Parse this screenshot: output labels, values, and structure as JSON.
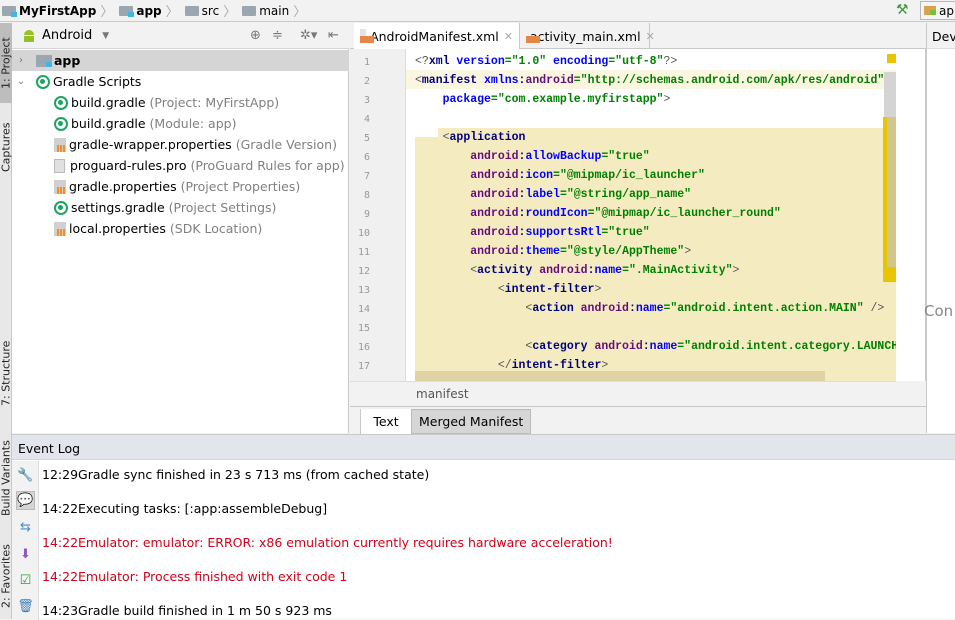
{
  "navbar": {
    "crumbs": [
      {
        "label": "MyFirstApp",
        "bold": true,
        "icon": "module-folder-icon"
      },
      {
        "label": "app",
        "bold": true,
        "icon": "module-folder-icon"
      },
      {
        "label": "src",
        "bold": false,
        "icon": "folder-icon"
      },
      {
        "label": "main",
        "bold": false,
        "icon": "folder-icon"
      }
    ],
    "run_config_label": "ap"
  },
  "left_strip": {
    "tabs": [
      "1: Project",
      "Captures",
      "7: Structure",
      "Build Variants",
      "2: Favorites"
    ]
  },
  "project_panel": {
    "view_selector": "Android",
    "tree": [
      {
        "label": "app",
        "hint": "",
        "icon": "module-folder-icon",
        "expanded": false,
        "selected": true,
        "level": 0
      },
      {
        "label": "Gradle Scripts",
        "hint": "",
        "icon": "gradle-icon",
        "expanded": true,
        "selected": false,
        "level": 0
      },
      {
        "label": "build.gradle",
        "hint": "(Project: MyFirstApp)",
        "icon": "gradle-icon",
        "level": 1
      },
      {
        "label": "build.gradle",
        "hint": "(Module: app)",
        "icon": "gradle-icon",
        "level": 1
      },
      {
        "label": "gradle-wrapper.properties",
        "hint": "(Gradle Version)",
        "icon": "properties-icon",
        "level": 1
      },
      {
        "label": "proguard-rules.pro",
        "hint": "(ProGuard Rules for app)",
        "icon": "text-file-icon",
        "level": 1
      },
      {
        "label": "gradle.properties",
        "hint": "(Project Properties)",
        "icon": "properties-icon",
        "level": 1
      },
      {
        "label": "settings.gradle",
        "hint": "(Project Settings)",
        "icon": "gradle-icon",
        "level": 1
      },
      {
        "label": "local.properties",
        "hint": "(SDK Location)",
        "icon": "properties-icon",
        "level": 1
      }
    ]
  },
  "editor": {
    "tabs": [
      {
        "label": "AndroidManifest.xml",
        "active": true
      },
      {
        "label": "activity_main.xml",
        "active": false
      }
    ],
    "line_numbers": [
      "1",
      "2",
      "3",
      "4",
      "5",
      "6",
      "7",
      "8",
      "9",
      "10",
      "11",
      "12",
      "13",
      "14",
      "15",
      "16",
      "17"
    ],
    "lines": [
      [
        {
          "c": "p",
          "t": "<?"
        },
        {
          "c": "t",
          "t": "xml "
        },
        {
          "c": "a",
          "t": "version"
        },
        {
          "c": "v",
          "t": "=\"1.0\" "
        },
        {
          "c": "a",
          "t": "encoding"
        },
        {
          "c": "v",
          "t": "=\"utf-8\""
        },
        {
          "c": "p",
          "t": "?>"
        }
      ],
      [
        {
          "c": "p",
          "t": "<"
        },
        {
          "c": "t",
          "t": "manifest "
        },
        {
          "c": "a",
          "t": "xmlns"
        },
        {
          "c": "t",
          "t": ":"
        },
        {
          "c": "n",
          "t": "android"
        },
        {
          "c": "v",
          "t": "=\"http://schemas.android.com/apk/res/android\""
        }
      ],
      [
        {
          "c": "t",
          "t": "    "
        },
        {
          "c": "a",
          "t": "package"
        },
        {
          "c": "v",
          "t": "=\"com.example.myfirstapp\""
        },
        {
          "c": "p",
          "t": ">"
        }
      ],
      [],
      [
        {
          "c": "t",
          "t": "    "
        },
        {
          "c": "p",
          "t": "<"
        },
        {
          "c": "t",
          "t": "application"
        }
      ],
      [
        {
          "c": "t",
          "t": "        "
        },
        {
          "c": "n",
          "t": "android"
        },
        {
          "c": "t",
          "t": ":"
        },
        {
          "c": "a",
          "t": "allowBackup"
        },
        {
          "c": "v",
          "t": "=\"true\""
        }
      ],
      [
        {
          "c": "t",
          "t": "        "
        },
        {
          "c": "n",
          "t": "android"
        },
        {
          "c": "t",
          "t": ":"
        },
        {
          "c": "a",
          "t": "icon"
        },
        {
          "c": "v",
          "t": "=\"@mipmap/ic_launcher\""
        }
      ],
      [
        {
          "c": "t",
          "t": "        "
        },
        {
          "c": "n",
          "t": "android"
        },
        {
          "c": "t",
          "t": ":"
        },
        {
          "c": "a",
          "t": "label"
        },
        {
          "c": "v",
          "t": "=\"@string/app_name\""
        }
      ],
      [
        {
          "c": "t",
          "t": "        "
        },
        {
          "c": "n",
          "t": "android"
        },
        {
          "c": "t",
          "t": ":"
        },
        {
          "c": "a",
          "t": "roundIcon"
        },
        {
          "c": "v",
          "t": "=\"@mipmap/ic_launcher_round\""
        }
      ],
      [
        {
          "c": "t",
          "t": "        "
        },
        {
          "c": "n",
          "t": "android"
        },
        {
          "c": "t",
          "t": ":"
        },
        {
          "c": "a",
          "t": "supportsRtl"
        },
        {
          "c": "v",
          "t": "=\"true\""
        }
      ],
      [
        {
          "c": "t",
          "t": "        "
        },
        {
          "c": "n",
          "t": "android"
        },
        {
          "c": "t",
          "t": ":"
        },
        {
          "c": "a",
          "t": "theme"
        },
        {
          "c": "v",
          "t": "=\"@style/AppTheme\""
        },
        {
          "c": "p",
          "t": ">"
        }
      ],
      [
        {
          "c": "t",
          "t": "        "
        },
        {
          "c": "p",
          "t": "<"
        },
        {
          "c": "t",
          "t": "activity "
        },
        {
          "c": "n",
          "t": "android"
        },
        {
          "c": "t",
          "t": ":"
        },
        {
          "c": "a",
          "t": "name"
        },
        {
          "c": "v",
          "t": "=\".MainActivity\""
        },
        {
          "c": "p",
          "t": ">"
        }
      ],
      [
        {
          "c": "t",
          "t": "            "
        },
        {
          "c": "p",
          "t": "<"
        },
        {
          "c": "t",
          "t": "intent-filter"
        },
        {
          "c": "p",
          "t": ">"
        }
      ],
      [
        {
          "c": "t",
          "t": "                "
        },
        {
          "c": "p",
          "t": "<"
        },
        {
          "c": "t",
          "t": "action "
        },
        {
          "c": "n",
          "t": "android"
        },
        {
          "c": "t",
          "t": ":"
        },
        {
          "c": "a",
          "t": "name"
        },
        {
          "c": "v",
          "t": "=\"android.intent.action.MAIN\" "
        },
        {
          "c": "p",
          "t": "/>"
        }
      ],
      [],
      [
        {
          "c": "t",
          "t": "                "
        },
        {
          "c": "p",
          "t": "<"
        },
        {
          "c": "t",
          "t": "category "
        },
        {
          "c": "n",
          "t": "android"
        },
        {
          "c": "t",
          "t": ":"
        },
        {
          "c": "a",
          "t": "name"
        },
        {
          "c": "v",
          "t": "=\"android.intent.category.LAUNCHER\""
        }
      ],
      [
        {
          "c": "t",
          "t": "            "
        },
        {
          "c": "p",
          "t": "</"
        },
        {
          "c": "t",
          "t": "intent-filter"
        },
        {
          "c": "p",
          "t": ">"
        }
      ]
    ],
    "breadcrumb": "manifest",
    "bottom_tabs": [
      {
        "label": "Text",
        "active": true
      },
      {
        "label": "Merged Manifest",
        "active": false
      }
    ]
  },
  "right_panel": {
    "title": "Device Fi",
    "content_text": "Con"
  },
  "event_log": {
    "title": "Event Log",
    "entries": [
      {
        "time": "12:29",
        "message": "Gradle sync finished in 23 s 713 ms (from cached state)",
        "error": false
      },
      {
        "time": "14:22",
        "message": "Executing tasks: [:app:assembleDebug]",
        "error": false
      },
      {
        "time": "14:22",
        "message": "Emulator: emulator: ERROR: x86 emulation currently requires hardware acceleration!",
        "error": true
      },
      {
        "time": "14:22",
        "message": "Emulator: Process finished with exit code 1",
        "error": true
      },
      {
        "time": "14:23",
        "message": "Gradle build finished in 1 m 50 s 923 ms",
        "error": false
      }
    ],
    "tools": [
      "settings-icon",
      "balloon-icon",
      "preferences-icon",
      "export-icon",
      "mark-read-icon",
      "trash-icon"
    ]
  },
  "colors": {
    "error": "#d0021b",
    "gradle": "#1ea362",
    "highlight": "#f5ebc1"
  }
}
